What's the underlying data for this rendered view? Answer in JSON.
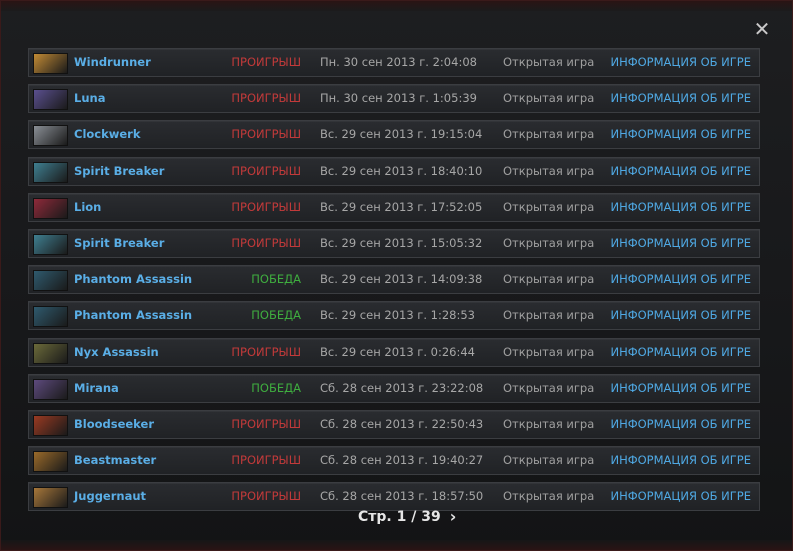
{
  "window": {
    "close_label": "✕"
  },
  "matches": [
    {
      "hero": "Windrunner",
      "hero_icon": "windrunner-portrait-icon",
      "hero_color": "#c28b35",
      "result": "ПРОИГРЫШ",
      "result_color": "#c23a3a",
      "date": "Пн. 30 сен 2013 г. 2:04:08",
      "mode": "Открытая игра",
      "info": "ИНФОРМАЦИЯ ОБ ИГРЕ"
    },
    {
      "hero": "Luna",
      "hero_icon": "luna-portrait-icon",
      "hero_color": "#5a4f8f",
      "result": "ПРОИГРЫШ",
      "result_color": "#c23a3a",
      "date": "Пн. 30 сен 2013 г. 1:05:39",
      "mode": "Открытая игра",
      "info": "ИНФОРМАЦИЯ ОБ ИГРЕ"
    },
    {
      "hero": "Clockwerk",
      "hero_icon": "clockwerk-portrait-icon",
      "hero_color": "#8a8f96",
      "result": "ПРОИГРЫШ",
      "result_color": "#c23a3a",
      "date": "Вс. 29 сен 2013 г. 19:15:04",
      "mode": "Открытая игра",
      "info": "ИНФОРМАЦИЯ ОБ ИГРЕ"
    },
    {
      "hero": "Spirit Breaker",
      "hero_icon": "spirit-breaker-portrait-icon",
      "hero_color": "#3f7f91",
      "result": "ПРОИГРЫШ",
      "result_color": "#c23a3a",
      "date": "Вс. 29 сен 2013 г. 18:40:10",
      "mode": "Открытая игра",
      "info": "ИНФОРМАЦИЯ ОБ ИГРЕ"
    },
    {
      "hero": "Lion",
      "hero_icon": "lion-portrait-icon",
      "hero_color": "#8f2a3a",
      "result": "ПРОИГРЫШ",
      "result_color": "#c23a3a",
      "date": "Вс. 29 сен 2013 г. 17:52:05",
      "mode": "Открытая игра",
      "info": "ИНФОРМАЦИЯ ОБ ИГРЕ"
    },
    {
      "hero": "Spirit Breaker",
      "hero_icon": "spirit-breaker-portrait-icon",
      "hero_color": "#3f7f91",
      "result": "ПРОИГРЫШ",
      "result_color": "#c23a3a",
      "date": "Вс. 29 сен 2013 г. 15:05:32",
      "mode": "Открытая игра",
      "info": "ИНФОРМАЦИЯ ОБ ИГРЕ"
    },
    {
      "hero": "Phantom Assassin",
      "hero_icon": "phantom-assassin-portrait-icon",
      "hero_color": "#2f5a6e",
      "result": "ПОБЕДА",
      "result_color": "#3fae3f",
      "date": "Вс. 29 сен 2013 г. 14:09:38",
      "mode": "Открытая игра",
      "info": "ИНФОРМАЦИЯ ОБ ИГРЕ"
    },
    {
      "hero": "Phantom Assassin",
      "hero_icon": "phantom-assassin-portrait-icon",
      "hero_color": "#2f5a6e",
      "result": "ПОБЕДА",
      "result_color": "#3fae3f",
      "date": "Вс. 29 сен 2013 г. 1:28:53",
      "mode": "Открытая игра",
      "info": "ИНФОРМАЦИЯ ОБ ИГРЕ"
    },
    {
      "hero": "Nyx Assassin",
      "hero_icon": "nyx-assassin-portrait-icon",
      "hero_color": "#6b6a3a",
      "result": "ПРОИГРЫШ",
      "result_color": "#c23a3a",
      "date": "Вс. 29 сен 2013 г. 0:26:44",
      "mode": "Открытая игра",
      "info": "ИНФОРМАЦИЯ ОБ ИГРЕ"
    },
    {
      "hero": "Mirana",
      "hero_icon": "mirana-portrait-icon",
      "hero_color": "#5d4a7d",
      "result": "ПОБЕДА",
      "result_color": "#3fae3f",
      "date": "Сб. 28 сен 2013 г. 23:22:08",
      "mode": "Открытая игра",
      "info": "ИНФОРМАЦИЯ ОБ ИГРЕ"
    },
    {
      "hero": "Bloodseeker",
      "hero_icon": "bloodseeker-portrait-icon",
      "hero_color": "#9a3a22",
      "result": "ПРОИГРЫШ",
      "result_color": "#c23a3a",
      "date": "Сб. 28 сен 2013 г. 22:50:43",
      "mode": "Открытая игра",
      "info": "ИНФОРМАЦИЯ ОБ ИГРЕ"
    },
    {
      "hero": "Beastmaster",
      "hero_icon": "beastmaster-portrait-icon",
      "hero_color": "#9a6a2a",
      "result": "ПРОИГРЫШ",
      "result_color": "#c23a3a",
      "date": "Сб. 28 сен 2013 г. 19:40:27",
      "mode": "Открытая игра",
      "info": "ИНФОРМАЦИЯ ОБ ИГРЕ"
    },
    {
      "hero": "Juggernaut",
      "hero_icon": "juggernaut-portrait-icon",
      "hero_color": "#a7773a",
      "result": "ПРОИГРЫШ",
      "result_color": "#c23a3a",
      "date": "Сб. 28 сен 2013 г. 18:57:50",
      "mode": "Открытая игра",
      "info": "ИНФОРМАЦИЯ ОБ ИГРЕ"
    }
  ],
  "pagination": {
    "label": "Стр. 1 / 39",
    "next": "›"
  }
}
